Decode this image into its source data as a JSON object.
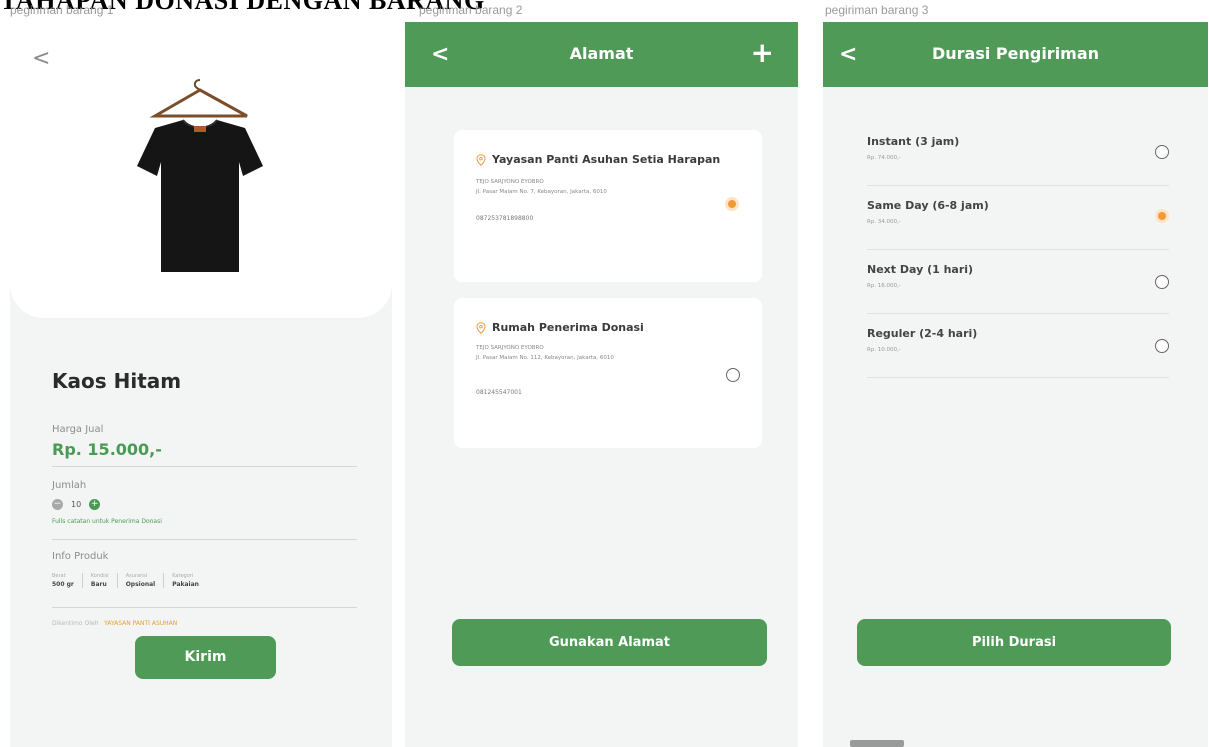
{
  "page_title": "TAHAPAN DONASI DENGAN BARANG",
  "frames": {
    "frame1_label": "pegiriman barang 1",
    "frame2_label": "pegiriman barang 2",
    "frame3_label": "pegiriman barang 3"
  },
  "icons": {
    "back": "chevron-left-icon",
    "add": "plus-icon",
    "pin": "location-pin-icon",
    "product": "tshirt-image"
  },
  "colors": {
    "primary_green": "#4e9a56",
    "accent_orange": "#f09a35",
    "background": "#f3f4f4"
  },
  "product": {
    "back_symbol": "<",
    "name": "Kaos Hitam",
    "price_label": "Harga Jual",
    "price": "Rp. 15.000,-",
    "qty_label": "Jumlah",
    "qty_minus": "−",
    "qty_value": "10",
    "qty_plus": "+",
    "qty_note": "Fulls catatan untuk Penerima Donasi",
    "info_label": "Info Produk",
    "info": [
      {
        "key": "Berat",
        "value": "500 gr"
      },
      {
        "key": "Kondisi",
        "value": "Baru"
      },
      {
        "key": "Asuransi",
        "value": "Opsional"
      },
      {
        "key": "Kategori",
        "value": "Pakaian"
      }
    ],
    "cut_text": "Dikentimo Oleh",
    "cut_highlight": "YAYASAN PANTI ASUHAN",
    "submit_label": "Kirim"
  },
  "address": {
    "back_symbol": "<",
    "title": "Alamat",
    "add_symbol": "+",
    "cards": [
      {
        "name": "Yayasan Panti Asuhan Setia Harapan",
        "recipient": "TEJO SARJYONO EYOBRO",
        "street": "Jl. Pasar Malam No. 7, Kebayoran, Jakarta, 6010",
        "phone": "087253781898800",
        "selected": true
      },
      {
        "name": "Rumah Penerima Donasi",
        "recipient": "TEJO SARJYONO EYOBRO",
        "street": "Jl. Pasar Malam No. 112, Kebayoran, Jakarta, 6010",
        "phone": "081245547001",
        "selected": false
      }
    ],
    "submit_label": "Gunakan Alamat"
  },
  "duration": {
    "back_symbol": "<",
    "title": "Durasi Pengiriman",
    "options": [
      {
        "name": "Instant (3 jam)",
        "price": "Rp. 74.000,-",
        "selected": false
      },
      {
        "name": "Same Day (6-8 jam)",
        "price": "Rp. 34.000,-",
        "selected": true
      },
      {
        "name": "Next Day (1 hari)",
        "price": "Rp. 16.000,-",
        "selected": false
      },
      {
        "name": "Reguler (2-4 hari)",
        "price": "Rp. 10.000,-",
        "selected": false
      }
    ],
    "submit_label": "Pilih Durasi"
  }
}
